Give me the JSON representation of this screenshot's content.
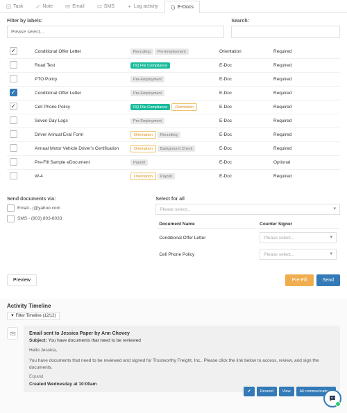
{
  "tabs": [
    {
      "label": "Task",
      "icon": "check-square"
    },
    {
      "label": "Note",
      "icon": "pencil"
    },
    {
      "label": "Email",
      "icon": "envelope"
    },
    {
      "label": "SMS",
      "icon": "comment"
    },
    {
      "label": "Log activity",
      "icon": "plus"
    },
    {
      "label": "E-Docs",
      "icon": "file",
      "active": true
    }
  ],
  "filter_label": "Filter by labels:",
  "filter_placeholder": "Please select...",
  "search_label": "Search:",
  "rows": [
    {
      "chk": "checked",
      "name": "Conditional Offer Letter",
      "pills": [
        {
          "t": "Recruiting"
        },
        {
          "t": "Pre-Employment"
        }
      ],
      "type": "Orientation",
      "req": "Required"
    },
    {
      "chk": "",
      "name": "Road Test",
      "pills": [
        {
          "t": "DQ File Compliance",
          "cls": "green"
        }
      ],
      "type": "E-Doc",
      "req": "Required"
    },
    {
      "chk": "",
      "name": "PTO Policy",
      "pills": [
        {
          "t": "Pre-Employment"
        }
      ],
      "type": "E-Doc",
      "req": "Required"
    },
    {
      "chk": "filled",
      "name": "Conditional Offer Letter",
      "pills": [
        {
          "t": "Pre-Employment"
        }
      ],
      "type": "E-Doc",
      "req": "Required"
    },
    {
      "chk": "checked",
      "name": "Cell Phone Policy",
      "pills": [
        {
          "t": "DQ File Compliance",
          "cls": "green"
        },
        {
          "t": "Orientation",
          "cls": "orange-outline"
        }
      ],
      "type": "E-Doc",
      "req": "Required"
    },
    {
      "chk": "",
      "name": "Seven Day Logs",
      "pills": [
        {
          "t": "Pre-Employment"
        }
      ],
      "type": "E-Doc",
      "req": "Required"
    },
    {
      "chk": "",
      "name": "Driver Annual Eval Form",
      "pills": [
        {
          "t": "Orientation",
          "cls": "orange-outline"
        },
        {
          "t": "Recruiting"
        }
      ],
      "type": "E-Doc",
      "req": "Required"
    },
    {
      "chk": "",
      "name": "Annual Motor Vehicle Driver's Certification",
      "pills": [
        {
          "t": "Orientation",
          "cls": "orange-outline"
        },
        {
          "t": "Background Check"
        }
      ],
      "type": "E-Doc",
      "req": "Required"
    },
    {
      "chk": "",
      "name": "Pre-Fill Sample eDocument",
      "pills": [
        {
          "t": "Payroll"
        }
      ],
      "type": "E-Doc",
      "req": "Optional"
    },
    {
      "chk": "",
      "name": "W-4",
      "pills": [
        {
          "t": "Orientation",
          "cls": "orange-outline"
        },
        {
          "t": "Payroll"
        }
      ],
      "type": "E-Doc",
      "req": "Required"
    }
  ],
  "send": {
    "via_label": "Send documents via:",
    "email_opt": "Email - j@yahoo.com",
    "sms_opt": "SMS - (803) 803-8033",
    "select_all_label": "Select for all",
    "select_placeholder": "Please select...",
    "col_doc": "Document Name",
    "col_cs": "Counter Signer",
    "docs": [
      {
        "name": "Conditional Offer Letter",
        "sel": "Please select..."
      },
      {
        "name": "Cell Phone Policy",
        "sel": "Please select..."
      }
    ]
  },
  "buttons": {
    "preview": "Preview",
    "prefill": "Pre-Fill",
    "send": "Send"
  },
  "timeline": {
    "title": "Activity Timeline",
    "filter": "Filter Timeline (12/12)",
    "item": {
      "title": "Email sent to Jessica Paper by Ann Chovey",
      "subject_label": "Subject:",
      "subject": "You have documents that need to be reviewed",
      "greeting": "Hello Jessica,",
      "body": "You have documents that need to be reviewed and signed for Trustworthy Freight, Inc.. Please click the link below to access, review, and sign the documents.",
      "expand": "Expand",
      "created": "Created Wednesday at 10:00am",
      "btn_resend": "Resend",
      "btn_view": "View",
      "btn_all": "All communications"
    }
  }
}
